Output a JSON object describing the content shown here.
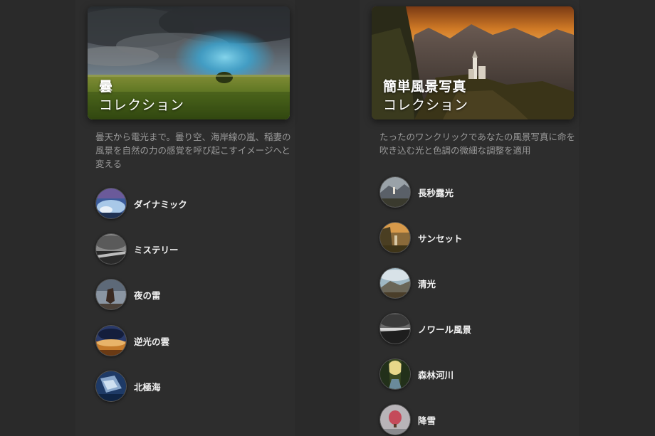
{
  "collections": [
    {
      "hero_title": "曇",
      "hero_subtitle": "コレクション",
      "description": "曇天から電光まで。曇り空、海岸線の嵐、稲妻の風景を自然の力の感覚を呼び起こすイメージへと変える",
      "presets": [
        {
          "label": "ダイナミック",
          "icon": "dynamic-thumbnail"
        },
        {
          "label": "ミステリー",
          "icon": "mystery-thumbnail"
        },
        {
          "label": "夜の雷",
          "icon": "night-thunder-thumbnail"
        },
        {
          "label": "逆光の雲",
          "icon": "backlit-clouds-thumbnail"
        },
        {
          "label": "北極海",
          "icon": "arctic-ocean-thumbnail"
        }
      ]
    },
    {
      "hero_title": "簡単風景写真",
      "hero_subtitle": "コレクション",
      "description": "たったのワンクリックであなたの風景写真に命を吹き込む光と色調の微細な調整を適用",
      "presets": [
        {
          "label": "長秒露光",
          "icon": "long-exposure-thumbnail"
        },
        {
          "label": "サンセット",
          "icon": "sunset-thumbnail"
        },
        {
          "label": "清光",
          "icon": "clear-light-thumbnail"
        },
        {
          "label": "ノワール風景",
          "icon": "noir-landscape-thumbnail"
        },
        {
          "label": "森林河川",
          "icon": "forest-river-thumbnail"
        },
        {
          "label": "降雪",
          "icon": "snowfall-thumbnail"
        }
      ]
    }
  ]
}
